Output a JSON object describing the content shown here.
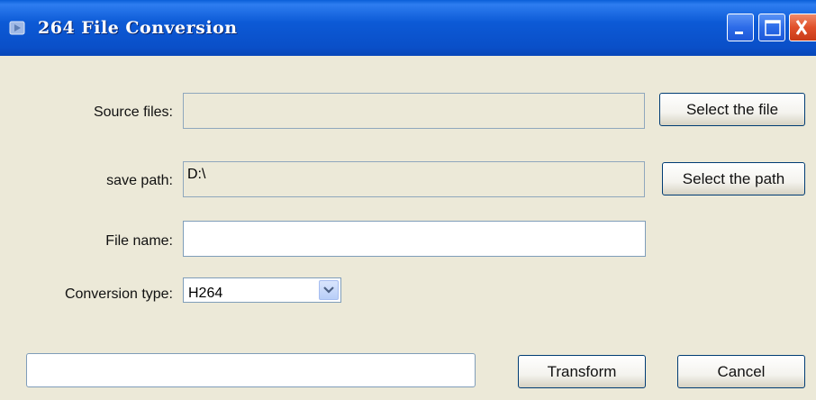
{
  "window": {
    "title": "264 File Conversion",
    "buttons": [
      "minimize-icon",
      "maximize-icon",
      "close-icon"
    ]
  },
  "form": {
    "source_files": {
      "label": "Source files:",
      "value": ""
    },
    "save_path": {
      "label": "save path:",
      "value": "D:\\"
    },
    "file_name": {
      "label": "File name:",
      "value": ""
    },
    "conversion_type": {
      "label": "Conversion type:",
      "selected": "H264"
    }
  },
  "buttons": {
    "select_file": "Select the file",
    "select_path": "Select the path",
    "transform": "Transform",
    "cancel": "Cancel"
  },
  "progress": {
    "value": 0
  },
  "colors": {
    "titlebar": "#0A4FC8",
    "background": "#ECE9D8",
    "close_button": "#E0502A"
  }
}
